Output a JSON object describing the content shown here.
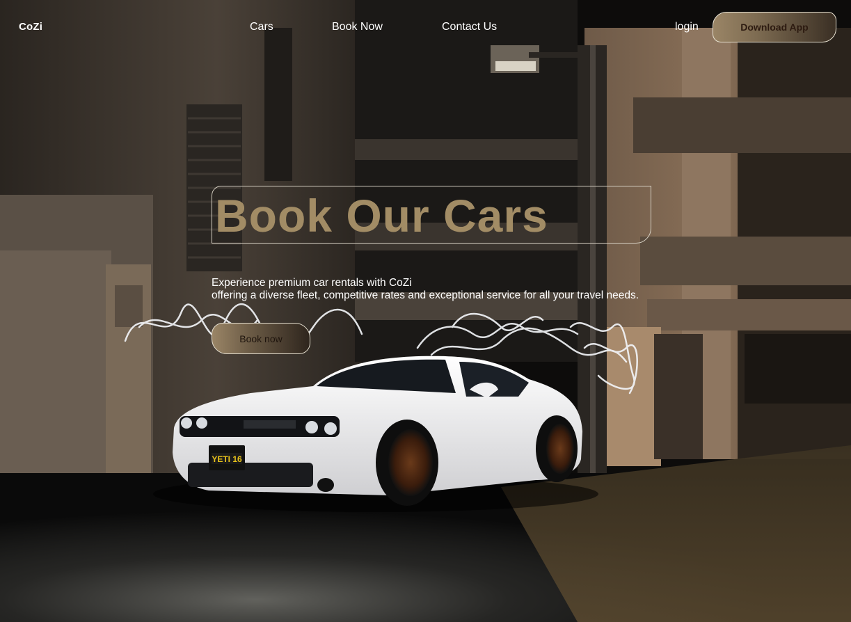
{
  "nav": {
    "brand": "CoZi",
    "links": [
      {
        "label": "Cars"
      },
      {
        "label": "Book Now"
      },
      {
        "label": "Contact Us"
      }
    ],
    "login_label": "login",
    "download_label": "Download App"
  },
  "hero": {
    "title": "Book Our Cars",
    "description_line1": "Experience premium car rentals with CoZi",
    "description_line2": "offering a diverse fleet, competitive rates and exceptional service for all your travel needs.",
    "cta_label": "Book now"
  },
  "background": {
    "license_plate_text": "YETI 16"
  },
  "colors": {
    "accent_gold": "#a28c65",
    "text_white": "#ffffff",
    "button_text_dark": "#2c1a10"
  }
}
